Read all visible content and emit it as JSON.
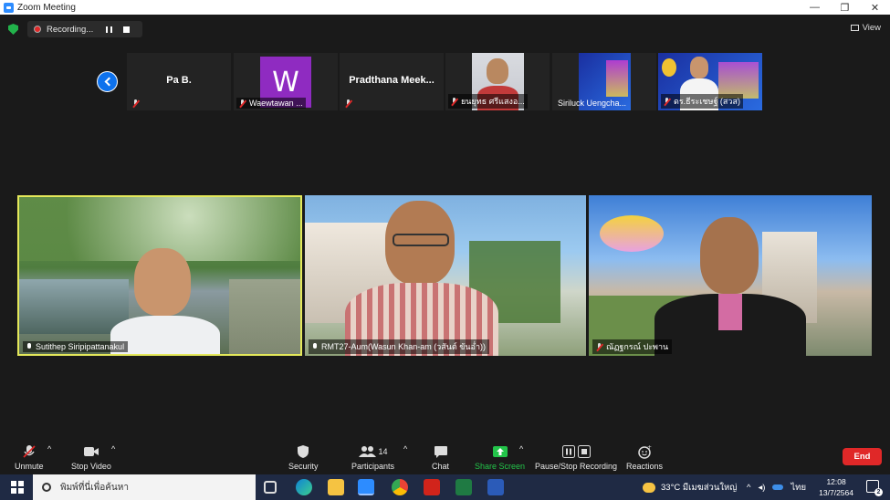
{
  "window": {
    "title": "Zoom Meeting",
    "minimize": "—",
    "restore": "❐",
    "close": "✕"
  },
  "recording": {
    "label": "Recording..."
  },
  "view": {
    "label": "View"
  },
  "thumbnails": [
    {
      "name": "Pa B.",
      "label": ""
    },
    {
      "name": "",
      "label": "Waewtawan ...",
      "avatar": "W"
    },
    {
      "name": "Pradthana  Meek...",
      "label": ""
    },
    {
      "name": "",
      "label": "ยนยุทธ ศรีแสงอ..."
    },
    {
      "name": "",
      "label": "Siriluck Uengcha..."
    },
    {
      "name": "",
      "label": "ดร.ธีระเชษฐ์ (สวส)"
    }
  ],
  "tiles": [
    {
      "label": "Sutithep Siripipattanakul",
      "active": true
    },
    {
      "label": "RMT27-Aum(Wasun Khan-am (วสันต์ ขันอ่ำ))",
      "active": false
    },
    {
      "label": "ณัฏฐกรณ์ ปะพาน",
      "active": false
    }
  ],
  "toolbar": {
    "unmute": "Unmute",
    "stop_video": "Stop Video",
    "security": "Security",
    "participants": "Participants",
    "participants_count": "14",
    "chat": "Chat",
    "share_screen": "Share Screen",
    "pause_recording": "Pause/Stop Recording",
    "reactions": "Reactions",
    "end": "End"
  },
  "taskbar": {
    "search_placeholder": "พิมพ์ที่นี่เพื่อค้นหา",
    "weather": "33°C  มีเมฆส่วนใหญ่",
    "lang": "ไทย",
    "time": "12:08",
    "date": "13/7/2564",
    "notifications": "2"
  },
  "colors": {
    "active_speaker": "#e4e85a",
    "zoom_blue": "#0e72ed",
    "share_green": "#23c44a",
    "end_red": "#e02828"
  }
}
